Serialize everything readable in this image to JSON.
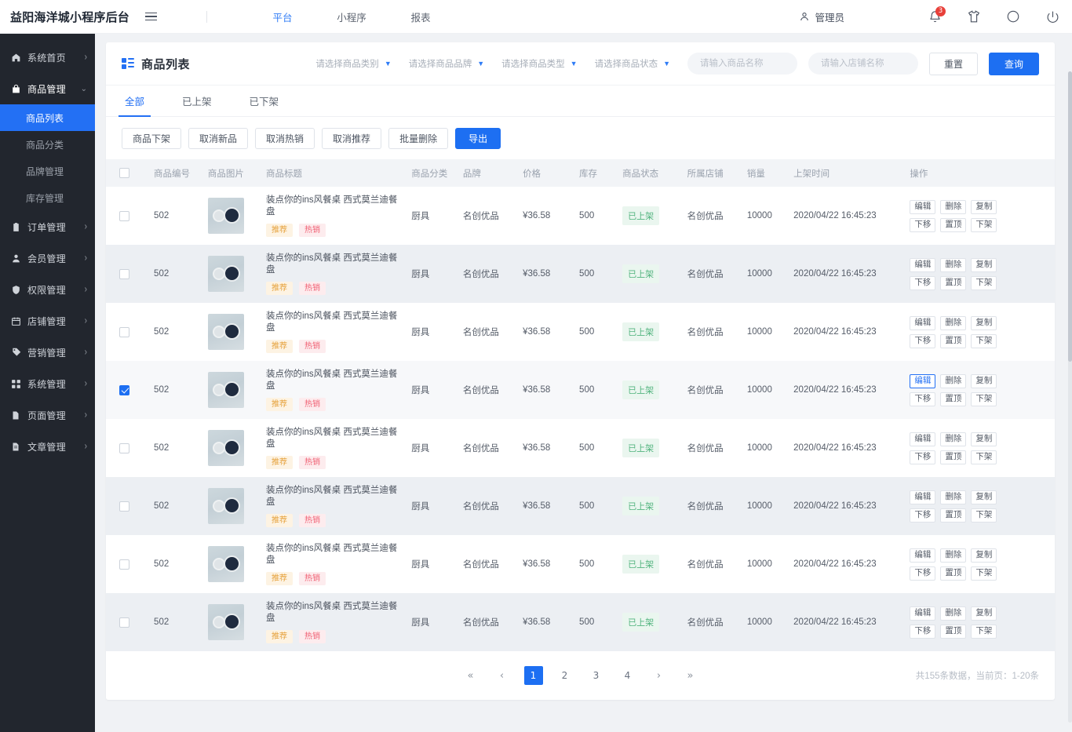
{
  "header": {
    "brand": "益阳海洋城小程序后台",
    "menu_icon": "hamburger-icon",
    "nav": [
      {
        "label": "平台",
        "active": true
      },
      {
        "label": "小程序",
        "active": false
      },
      {
        "label": "报表",
        "active": false
      }
    ],
    "user": "管理员",
    "notification_count": "3",
    "icons": [
      "user-icon",
      "bell-icon",
      "shirt-icon",
      "circle-icon",
      "power-icon"
    ]
  },
  "sidebar": {
    "items": [
      {
        "label": "系统首页",
        "icon": "home-icon",
        "arrow": "›",
        "expanded": false
      },
      {
        "label": "商品管理",
        "icon": "bag-icon",
        "arrow": "⌄",
        "expanded": true,
        "children": [
          {
            "label": "商品列表",
            "active": true
          },
          {
            "label": "商品分类",
            "active": false
          },
          {
            "label": "品牌管理",
            "active": false
          },
          {
            "label": "库存管理",
            "active": false
          }
        ]
      },
      {
        "label": "订单管理",
        "icon": "clipboard-icon",
        "arrow": "›",
        "expanded": false
      },
      {
        "label": "会员管理",
        "icon": "person-icon",
        "arrow": "›",
        "expanded": false
      },
      {
        "label": "权限管理",
        "icon": "shield-icon",
        "arrow": "›",
        "expanded": false
      },
      {
        "label": "店铺管理",
        "icon": "store-icon",
        "arrow": "›",
        "expanded": false
      },
      {
        "label": "营销管理",
        "icon": "tag-icon",
        "arrow": "›",
        "expanded": false
      },
      {
        "label": "系统管理",
        "icon": "grid-icon",
        "arrow": "›",
        "expanded": false
      },
      {
        "label": "页面管理",
        "icon": "page-icon",
        "arrow": "›",
        "expanded": false
      },
      {
        "label": "文章管理",
        "icon": "document-icon",
        "arrow": "›",
        "expanded": false
      }
    ]
  },
  "page": {
    "title": "商品列表",
    "title_icon": "list-blocks-icon",
    "filters": {
      "selects": [
        {
          "label": "请选择商品类别"
        },
        {
          "label": "请选择商品品牌"
        },
        {
          "label": "请选择商品类型"
        },
        {
          "label": "请选择商品状态"
        }
      ],
      "product_name_placeholder": "请输入商品名称",
      "product_name_value": "",
      "shop_name_placeholder": "请输入店铺名称",
      "shop_name_value": "",
      "reset_label": "重置",
      "query_label": "查询"
    },
    "tabs": [
      {
        "label": "全部",
        "active": true
      },
      {
        "label": "已上架",
        "active": false
      },
      {
        "label": "已下架",
        "active": false
      }
    ],
    "actions": [
      {
        "label": "商品下架",
        "primary": false
      },
      {
        "label": "取消新品",
        "primary": false
      },
      {
        "label": "取消热销",
        "primary": false
      },
      {
        "label": "取消推荐",
        "primary": false
      },
      {
        "label": "批量删除",
        "primary": false
      },
      {
        "label": "导出",
        "primary": true
      }
    ]
  },
  "table": {
    "columns": [
      "",
      "商品编号",
      "商品图片",
      "商品标题",
      "商品分类",
      "品牌",
      "价格",
      "库存",
      "商品状态",
      "所属店铺",
      "销量",
      "上架时间",
      "操作"
    ],
    "row_ops": [
      "编辑",
      "删除",
      "复制",
      "下移",
      "置顶",
      "下架"
    ],
    "rows": [
      {
        "checked": false,
        "id": "502",
        "thumb": "product-thumb",
        "title": "装点你的ins风餐桌 西式莫兰迪餐盘",
        "tags": [
          "推荐",
          "热销"
        ],
        "category": "厨具",
        "brand": "名创优品",
        "price": "¥36.58",
        "stock": "500",
        "status": "已上架",
        "shop": "名创优品",
        "sales": "10000",
        "listed_at": "2020/04/22 16:45:23",
        "highlight_edit": false
      },
      {
        "checked": false,
        "id": "502",
        "thumb": "product-thumb",
        "title": "装点你的ins风餐桌 西式莫兰迪餐盘",
        "tags": [
          "推荐",
          "热销"
        ],
        "category": "厨具",
        "brand": "名创优品",
        "price": "¥36.58",
        "stock": "500",
        "status": "已上架",
        "shop": "名创优品",
        "sales": "10000",
        "listed_at": "2020/04/22 16:45:23",
        "highlight_edit": false
      },
      {
        "checked": false,
        "id": "502",
        "thumb": "product-thumb",
        "title": "装点你的ins风餐桌 西式莫兰迪餐盘",
        "tags": [
          "推荐",
          "热销"
        ],
        "category": "厨具",
        "brand": "名创优品",
        "price": "¥36.58",
        "stock": "500",
        "status": "已上架",
        "shop": "名创优品",
        "sales": "10000",
        "listed_at": "2020/04/22 16:45:23",
        "highlight_edit": false
      },
      {
        "checked": true,
        "id": "502",
        "thumb": "product-thumb",
        "title": "装点你的ins风餐桌 西式莫兰迪餐盘",
        "tags": [
          "推荐",
          "热销"
        ],
        "category": "厨具",
        "brand": "名创优品",
        "price": "¥36.58",
        "stock": "500",
        "status": "已上架",
        "shop": "名创优品",
        "sales": "10000",
        "listed_at": "2020/04/22 16:45:23",
        "highlight_edit": true
      },
      {
        "checked": false,
        "id": "502",
        "thumb": "product-thumb",
        "title": "装点你的ins风餐桌 西式莫兰迪餐盘",
        "tags": [
          "推荐",
          "热销"
        ],
        "category": "厨具",
        "brand": "名创优品",
        "price": "¥36.58",
        "stock": "500",
        "status": "已上架",
        "shop": "名创优品",
        "sales": "10000",
        "listed_at": "2020/04/22 16:45:23",
        "highlight_edit": false
      },
      {
        "checked": false,
        "id": "502",
        "thumb": "product-thumb",
        "title": "装点你的ins风餐桌 西式莫兰迪餐盘",
        "tags": [
          "推荐",
          "热销"
        ],
        "category": "厨具",
        "brand": "名创优品",
        "price": "¥36.58",
        "stock": "500",
        "status": "已上架",
        "shop": "名创优品",
        "sales": "10000",
        "listed_at": "2020/04/22 16:45:23",
        "highlight_edit": false
      },
      {
        "checked": false,
        "id": "502",
        "thumb": "product-thumb",
        "title": "装点你的ins风餐桌 西式莫兰迪餐盘",
        "tags": [
          "推荐",
          "热销"
        ],
        "category": "厨具",
        "brand": "名创优品",
        "price": "¥36.58",
        "stock": "500",
        "status": "已上架",
        "shop": "名创优品",
        "sales": "10000",
        "listed_at": "2020/04/22 16:45:23",
        "highlight_edit": false
      },
      {
        "checked": false,
        "id": "502",
        "thumb": "product-thumb",
        "title": "装点你的ins风餐桌 西式莫兰迪餐盘",
        "tags": [
          "推荐",
          "热销"
        ],
        "category": "厨具",
        "brand": "名创优品",
        "price": "¥36.58",
        "stock": "500",
        "status": "已上架",
        "shop": "名创优品",
        "sales": "10000",
        "listed_at": "2020/04/22 16:45:23",
        "highlight_edit": false
      }
    ]
  },
  "pagination": {
    "first": "«",
    "prev": "‹",
    "next": "›",
    "last": "»",
    "pages": [
      "1",
      "2",
      "3",
      "4"
    ],
    "current": "1",
    "info": "共155条数据，当前页：1-20条"
  },
  "colors": {
    "accent": "#1d6ff2",
    "sidebar_bg": "#22262e",
    "page_bg": "#f0f2f5",
    "status_green": "#53b47f",
    "tag_orange": "#e6a23c",
    "tag_red": "#f06073",
    "badge_red": "#e8403a"
  }
}
